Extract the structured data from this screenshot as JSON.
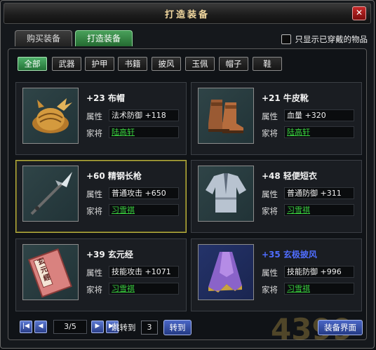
{
  "window": {
    "title": "打造装备",
    "close": "✕"
  },
  "tabs": [
    {
      "label": "购买装备"
    },
    {
      "label": "打造装备"
    }
  ],
  "only_worn": {
    "label": "只显示已穿戴的物品",
    "checked": false
  },
  "filters": [
    "全部",
    "武器",
    "护甲",
    "书籍",
    "披风",
    "玉佩",
    "帽子",
    "鞋"
  ],
  "items": [
    {
      "name": "+23  布帽",
      "attr_label": "属性",
      "attr": "法术防御 +118",
      "general_label": "家将",
      "general": "陆高轩",
      "icon": "cloth-hat-icon"
    },
    {
      "name": "+21  牛皮靴",
      "attr_label": "属性",
      "attr": "血量 +320",
      "general_label": "家将",
      "general": "陆高轩",
      "icon": "leather-boots-icon"
    },
    {
      "name": "+60  精钢长枪",
      "attr_label": "属性",
      "attr": "普通攻击 +650",
      "general_label": "家将",
      "general": "习雪祺",
      "icon": "steel-spear-icon"
    },
    {
      "name": "+48  轻便短衣",
      "attr_label": "属性",
      "attr": "普通防御 +311",
      "general_label": "家将",
      "general": "习雪祺",
      "icon": "short-robe-icon"
    },
    {
      "name": "+39  玄元经",
      "attr_label": "属性",
      "attr": "技能攻击 +1071",
      "general_label": "家将",
      "general": "习雪祺",
      "icon": "scripture-book-icon",
      "book_title": "玄元經"
    },
    {
      "name": "+35  玄极披风",
      "attr_label": "属性",
      "attr": "技能防御 +996",
      "general_label": "家将",
      "general": "习雪祺",
      "icon": "purple-cloak-icon",
      "name_color": "#4f6dff"
    }
  ],
  "pager": {
    "page": "3/5",
    "jump_label": "跳转到",
    "jump_value": "3",
    "go_label": "转到"
  },
  "equip_screen_label": "装备界面",
  "watermark": "4399",
  "colors": {
    "accent_green": "#2e8a42",
    "general_link": "#39d13e",
    "selected_border": "#b9b042",
    "blue_name": "#4f6dff"
  }
}
